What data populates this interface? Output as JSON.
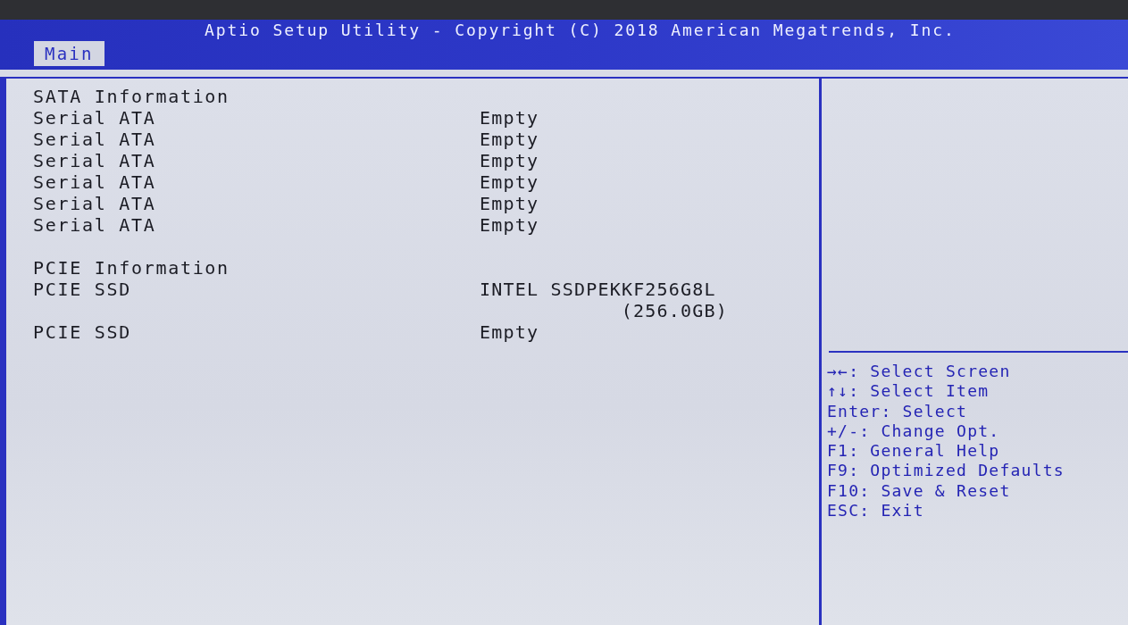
{
  "window": {
    "title": "Aptio Setup Utility - Copyright (C) 2018 American Megatrends, Inc."
  },
  "tabs": [
    {
      "label": "Main",
      "selected": true
    }
  ],
  "sections": [
    {
      "title": "SATA Information",
      "items": [
        {
          "label": "Serial ATA",
          "value_lines": [
            "Empty"
          ]
        },
        {
          "label": "Serial ATA",
          "value_lines": [
            "Empty"
          ]
        },
        {
          "label": "Serial ATA",
          "value_lines": [
            "Empty"
          ]
        },
        {
          "label": "Serial ATA",
          "value_lines": [
            "Empty"
          ]
        },
        {
          "label": "Serial ATA",
          "value_lines": [
            "Empty"
          ]
        },
        {
          "label": "Serial ATA",
          "value_lines": [
            "Empty"
          ]
        }
      ]
    },
    {
      "title": "PCIE Information",
      "items": [
        {
          "label": "PCIE SSD",
          "value_lines": [
            "INTEL SSDPEKKF256G8L",
            "(256.0GB)"
          ]
        },
        {
          "label": "PCIE SSD",
          "value_lines": [
            "Empty"
          ]
        }
      ]
    }
  ],
  "key_help": [
    "→←: Select Screen",
    "↑↓: Select Item",
    "Enter: Select",
    "+/-: Change Opt.",
    "F1: General Help",
    "F9: Optimized Defaults",
    "F10: Save & Reset",
    "ESC: Exit"
  ]
}
